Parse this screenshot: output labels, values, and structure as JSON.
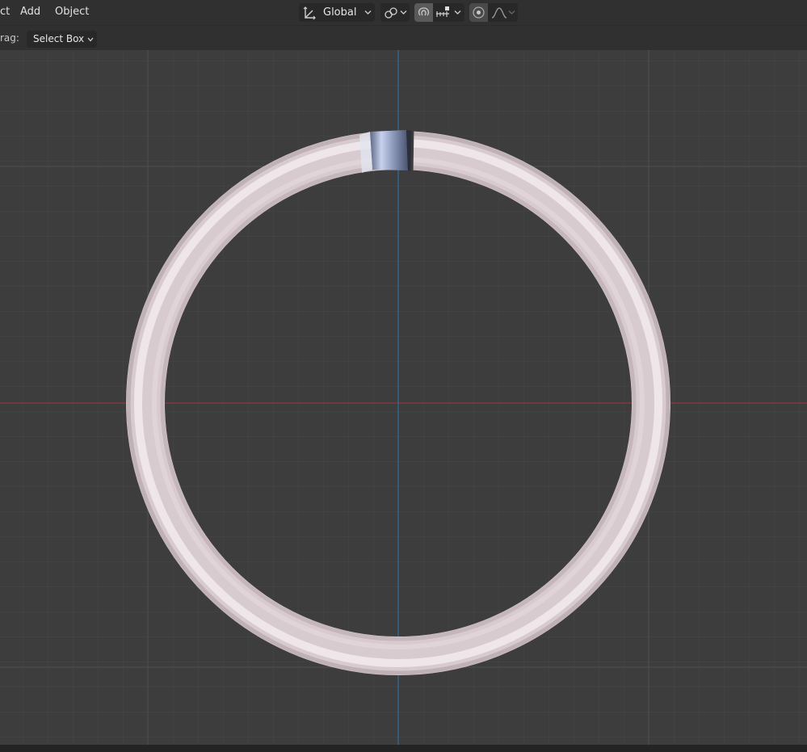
{
  "menu": {
    "select_partial": "ct",
    "add": "Add",
    "object": "Object"
  },
  "header": {
    "transform_orientation": "Global",
    "icons": {
      "orientation": "transform-orientation-icon",
      "pivot": "pivot-point-icon",
      "snap_toggle": "magnet-snap-icon",
      "snap_target": "snap-increment-icon",
      "proportional_toggle": "proportional-editing-icon",
      "falloff": "falloff-curve-icon"
    }
  },
  "toolbar": {
    "drag_label": "rag:",
    "drag_mode": "Select Box"
  },
  "viewport": {
    "background": "#3d3d3d",
    "grid_color": "#4a4a4a",
    "x_axis_color": "#9b3a3a",
    "y_axis_color": "#2f6d9e",
    "object": "ring-mesh",
    "object_color": "#d9ccd0"
  }
}
